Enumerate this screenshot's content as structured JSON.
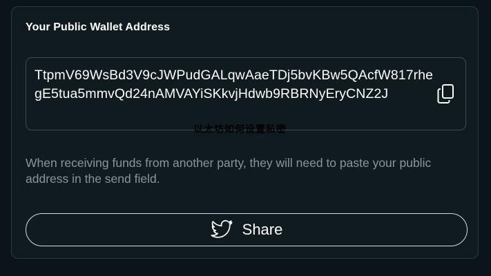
{
  "card": {
    "title": "Your Public Wallet Address"
  },
  "address": {
    "value": "TtpmV69WsBd3V9cJWPudGALqwAaeTDj5bvKBw5QAcfW817rhegE5tua5mmvQd24nAMVAYiSKkvjHdwb9RBRNyEryCNZ2J",
    "copy_icon": "copy-icon"
  },
  "watermark": {
    "text": "以太坊如何设置私密"
  },
  "description": {
    "text": "When receiving funds from another party, they will need to paste your public address in the send field."
  },
  "share": {
    "label": "Share",
    "icon": "twitter-icon"
  },
  "colors": {
    "background": "#0b1519",
    "card": "#101b20",
    "border": "#3b4a50",
    "muted_text": "#8a9599"
  }
}
